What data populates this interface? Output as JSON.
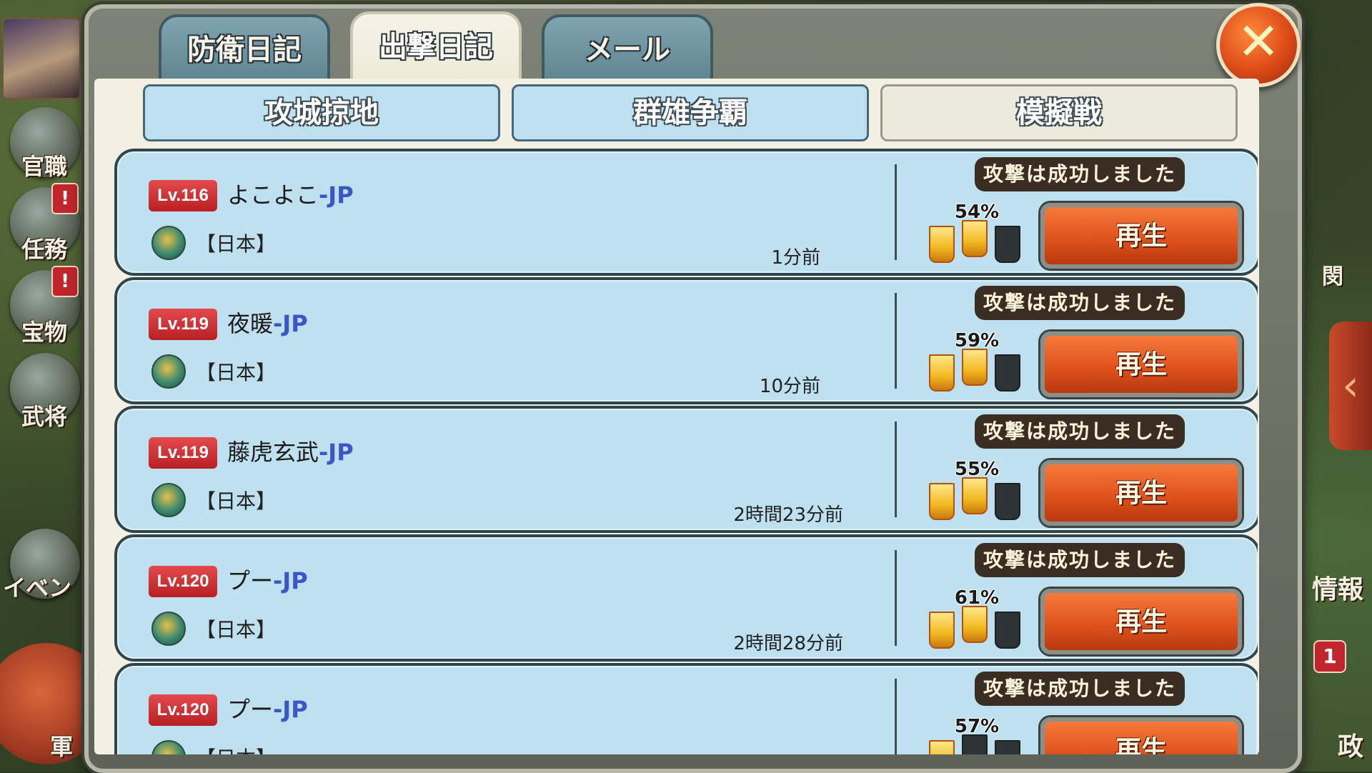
{
  "left_rail": {
    "items": [
      {
        "label": "官職",
        "alert": ""
      },
      {
        "label": "任務",
        "alert": "!"
      },
      {
        "label": "宝物",
        "alert": "!"
      },
      {
        "label": "武将",
        "alert": ""
      },
      {
        "label": "イベン",
        "alert": ""
      },
      {
        "label": "軍",
        "alert": ""
      }
    ]
  },
  "right_rail": {
    "info_label": "情報",
    "admin_label": "政",
    "badge_count": "1",
    "side_char": "閔"
  },
  "tabs": [
    {
      "label": "防衛日記",
      "active": false
    },
    {
      "label": "出撃日記",
      "active": true
    },
    {
      "label": "メール",
      "active": false
    }
  ],
  "subtabs": [
    {
      "label": "攻城掠地",
      "active": false
    },
    {
      "label": "群雄争覇",
      "active": false
    },
    {
      "label": "模擬戦",
      "active": true
    }
  ],
  "close_label": "✕",
  "records": [
    {
      "level": "Lv.116",
      "name": "よこよこ",
      "server": "-JP",
      "country": "【日本】",
      "time": "1分前",
      "result": "攻撃は成功しました",
      "percent": "54%",
      "banners": [
        "gold",
        "gold",
        "dark"
      ],
      "replay": "再生"
    },
    {
      "level": "Lv.119",
      "name": "夜暖",
      "server": "-JP",
      "country": "【日本】",
      "time": "10分前",
      "result": "攻撃は成功しました",
      "percent": "59%",
      "banners": [
        "gold",
        "gold",
        "dark"
      ],
      "replay": "再生"
    },
    {
      "level": "Lv.119",
      "name": "藤虎玄武",
      "server": "-JP",
      "country": "【日本】",
      "time": "2時間23分前",
      "result": "攻撃は成功しました",
      "percent": "55%",
      "banners": [
        "gold",
        "gold",
        "dark"
      ],
      "replay": "再生"
    },
    {
      "level": "Lv.120",
      "name": "プー",
      "server": "-JP",
      "country": "【日本】",
      "time": "2時間28分前",
      "result": "攻撃は成功しました",
      "percent": "61%",
      "banners": [
        "gold",
        "gold",
        "dark"
      ],
      "replay": "再生"
    },
    {
      "level": "Lv.120",
      "name": "プー",
      "server": "-JP",
      "country": "【日本】",
      "time": "",
      "result": "攻撃は成功しました",
      "percent": "57%",
      "banners": [
        "gold",
        "dark",
        "dark"
      ],
      "replay": "再生"
    }
  ]
}
